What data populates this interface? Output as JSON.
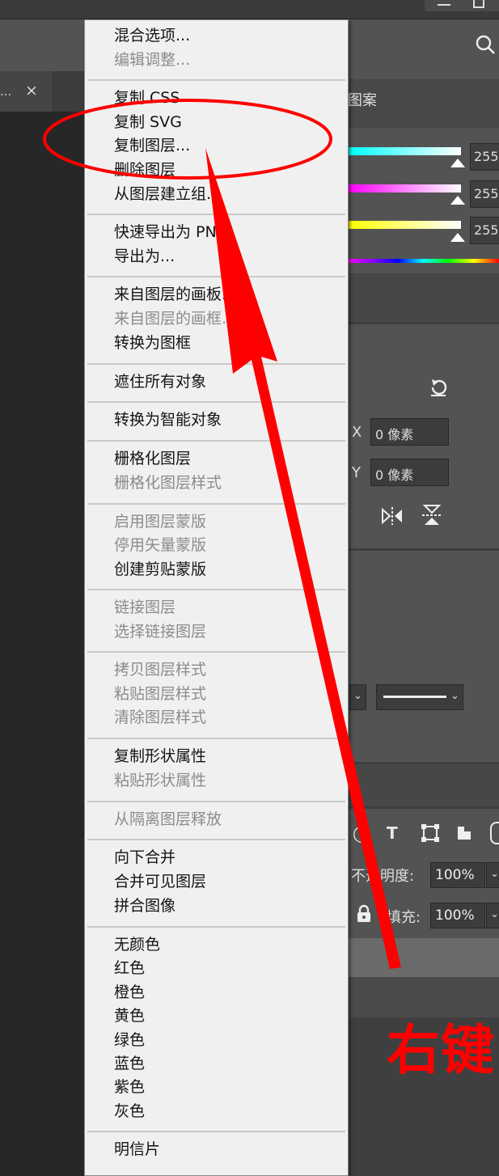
{
  "document_tab": {
    "label": "...",
    "close": "×"
  },
  "right_panel": {
    "tab_label": "图案",
    "sliders": [
      {
        "color": "#00ffff",
        "value": "255"
      },
      {
        "color": "#ff00ff",
        "value": "255"
      },
      {
        "color": "#ffff00",
        "value": "255"
      }
    ],
    "x_label": "X",
    "x_value": "0 像素",
    "y_label": "Y",
    "y_value": "0 像素",
    "opacity_label": "不透明度:",
    "opacity_value": "100%",
    "fill_label": "填充:",
    "fill_value": "100%"
  },
  "context_menu": {
    "groups": [
      [
        {
          "label": "混合选项...",
          "enabled": true
        },
        {
          "label": "编辑调整...",
          "enabled": false
        }
      ],
      [
        {
          "label": "复制 CSS",
          "enabled": true
        },
        {
          "label": "复制 SVG",
          "enabled": true
        },
        {
          "label": "复制图层...",
          "enabled": true
        },
        {
          "label": "删除图层",
          "enabled": true
        },
        {
          "label": "从图层建立组...",
          "enabled": true
        }
      ],
      [
        {
          "label": "快速导出为 PNG",
          "enabled": true
        },
        {
          "label": "导出为...",
          "enabled": true
        }
      ],
      [
        {
          "label": "来自图层的画板...",
          "enabled": true
        },
        {
          "label": "来自图层的画框...",
          "enabled": false
        },
        {
          "label": "转换为图框",
          "enabled": true
        }
      ],
      [
        {
          "label": "遮住所有对象",
          "enabled": true
        }
      ],
      [
        {
          "label": "转换为智能对象",
          "enabled": true
        }
      ],
      [
        {
          "label": "栅格化图层",
          "enabled": true
        },
        {
          "label": "栅格化图层样式",
          "enabled": false
        }
      ],
      [
        {
          "label": "启用图层蒙版",
          "enabled": false
        },
        {
          "label": "停用矢量蒙版",
          "enabled": false
        },
        {
          "label": "创建剪贴蒙版",
          "enabled": true
        }
      ],
      [
        {
          "label": "链接图层",
          "enabled": false
        },
        {
          "label": "选择链接图层",
          "enabled": false
        }
      ],
      [
        {
          "label": "拷贝图层样式",
          "enabled": false
        },
        {
          "label": "粘贴图层样式",
          "enabled": false
        },
        {
          "label": "清除图层样式",
          "enabled": false
        }
      ],
      [
        {
          "label": "复制形状属性",
          "enabled": true
        },
        {
          "label": "粘贴形状属性",
          "enabled": false
        }
      ],
      [
        {
          "label": "从隔离图层释放",
          "enabled": false
        }
      ],
      [
        {
          "label": "向下合并",
          "enabled": true
        },
        {
          "label": "合并可见图层",
          "enabled": true
        },
        {
          "label": "拼合图像",
          "enabled": true
        }
      ],
      [
        {
          "label": "无颜色",
          "enabled": true
        },
        {
          "label": "红色",
          "enabled": true
        },
        {
          "label": "橙色",
          "enabled": true
        },
        {
          "label": "黄色",
          "enabled": true
        },
        {
          "label": "绿色",
          "enabled": true
        },
        {
          "label": "蓝色",
          "enabled": true
        },
        {
          "label": "紫色",
          "enabled": true
        },
        {
          "label": "灰色",
          "enabled": true
        }
      ],
      [
        {
          "label": "明信片",
          "enabled": true
        }
      ]
    ]
  },
  "annotation": {
    "text": "右键",
    "color": "#ff0000"
  }
}
